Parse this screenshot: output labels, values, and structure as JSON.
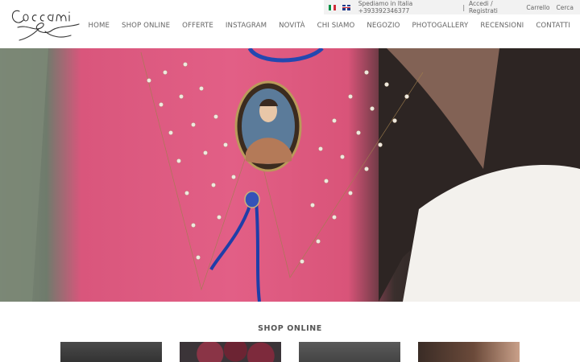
{
  "topbar": {
    "flags": [
      "italian-flag-icon",
      "uk-flag-icon"
    ],
    "shipping": "Spediamo in Italia +393392346377",
    "separator": "|",
    "login": "Accedi / Registrati",
    "cart": "Carrello",
    "search": "Cerca"
  },
  "brand": {
    "logo_text": "Coccami"
  },
  "nav": {
    "items": [
      "HOME",
      "SHOP ONLINE",
      "OFFERTE",
      "INSTAGRAM",
      "NOVITÀ",
      "CHI SIAMO",
      "NEGOZIO",
      "PHOTOGALLERY",
      "RECENSIONI",
      "CONTATTI"
    ]
  },
  "section": {
    "title": "SHOP ONLINE"
  },
  "colors": {
    "hero_pink": "#e25f86",
    "topbar_bg": "#f2f2f2",
    "text": "#666666"
  }
}
